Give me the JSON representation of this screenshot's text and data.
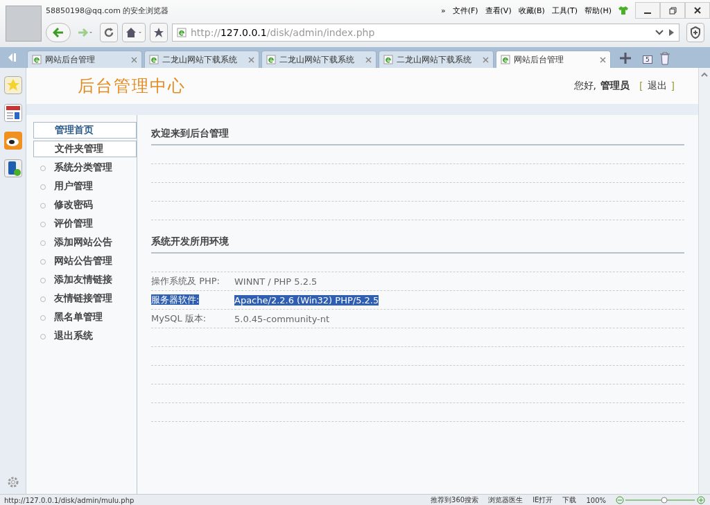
{
  "browser": {
    "account": "58850198@qq.com 的安全浏览器",
    "menu": [
      "»",
      "文件(F)",
      "查看(V)",
      "收藏(B)",
      "工具(T)",
      "帮助(H)"
    ],
    "url": {
      "host": "127.0.0.1",
      "prefix": "http://",
      "path": "/disk/admin/index.php"
    },
    "tabs": [
      {
        "label": "网站后台管理",
        "selected": false
      },
      {
        "label": "二龙山网站下载系统",
        "selected": false
      },
      {
        "label": "二龙山网站下载系统",
        "selected": false
      },
      {
        "label": "二龙山网站下载系统",
        "selected": false
      },
      {
        "label": "网站后台管理",
        "selected": true
      }
    ],
    "tab_count": "5"
  },
  "page": {
    "title": "后台管理中心",
    "greeting": "您好,",
    "user": "管理员",
    "logout": "退出",
    "bracket_open": "[",
    "bracket_close": "]",
    "menu": [
      {
        "label": "管理首页",
        "kind": "boxed",
        "selected": true
      },
      {
        "label": "文件夹管理",
        "kind": "boxed",
        "selected": false
      },
      {
        "label": "系统分类管理",
        "kind": "bullet",
        "selected": false
      },
      {
        "label": "用户管理",
        "kind": "bullet",
        "selected": false
      },
      {
        "label": "修改密码",
        "kind": "bullet",
        "selected": false
      },
      {
        "label": "评价管理",
        "kind": "bullet",
        "selected": false
      },
      {
        "label": "添加网站公告",
        "kind": "bullet",
        "selected": false
      },
      {
        "label": "网站公告管理",
        "kind": "bullet",
        "selected": false
      },
      {
        "label": "添加友情链接",
        "kind": "bullet",
        "selected": false
      },
      {
        "label": "友情链接管理",
        "kind": "bullet",
        "selected": false
      },
      {
        "label": "黑名单管理",
        "kind": "bullet",
        "selected": false
      },
      {
        "label": "退出系统",
        "kind": "bullet",
        "selected": false
      }
    ],
    "welcome": "欢迎来到后台管理",
    "env_title": "系统开发所用环境",
    "env": [
      {
        "label": "操作系统及 PHP:",
        "value": "WINNT / PHP 5.2.5",
        "selected": false
      },
      {
        "label": "服务器软件:",
        "value": "Apache/2.2.6 (Win32) PHP/5.2.5",
        "selected": true
      },
      {
        "label": "MySQL 版本:",
        "value": "5.0.45-community-nt",
        "selected": false
      }
    ]
  },
  "status_bar": {
    "url": "http://127.0.0.1/disk/admin/mulu.php",
    "items": [
      "推荐到360搜索",
      "浏览器医生",
      "IE打开",
      "下载"
    ],
    "zoom": "100%"
  }
}
